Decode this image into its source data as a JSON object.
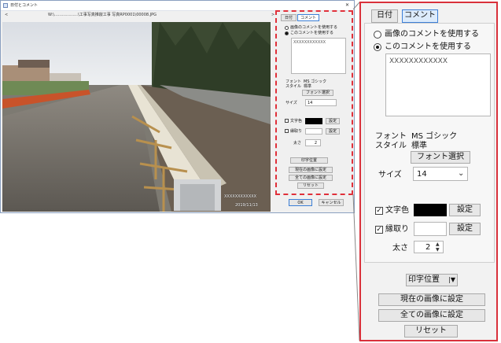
{
  "window": {
    "title": "日付とコメント",
    "file_path": "W:\\………………\\工事写真推敲工事  写真RP0001\\00008.JPG",
    "nav_prev": "<",
    "nav_next": ">",
    "close_glyph": "✕"
  },
  "photo": {
    "stamp_comment": "XXXXXXXXXXXX",
    "stamp_date": "2019/11/13"
  },
  "tabs": [
    "日付",
    "コメント"
  ],
  "comment": {
    "use_image_comment": "画像のコメントを使用する",
    "use_this_comment": "このコメントを使用する",
    "text": "XXXXXXXXXXXX"
  },
  "font": {
    "label": "フォント\nスタイル",
    "label_line1": "フォント",
    "label_line2": "スタイル",
    "name": "MS ゴシック",
    "style": "標準",
    "select_button": "フォント選択",
    "size_label": "サイズ",
    "size_value": "14"
  },
  "text_color": {
    "label": "文字色",
    "swatch": "#000000",
    "set_button": "設定",
    "checked": true
  },
  "outline": {
    "label": "縁取り",
    "swatch": "#ffffff",
    "set_button": "設定",
    "checked": true,
    "thickness_label": "太さ",
    "thickness_value": "2"
  },
  "actions": {
    "print_position": "印字位置",
    "apply_current": "現在の画像に設定",
    "apply_all": "全ての画像に設定",
    "reset": "リセット"
  },
  "dialog_buttons": {
    "ok": "OK",
    "cancel": "キャンセル"
  },
  "colors": {
    "highlight": "#d9313b",
    "tab_active_border": "#3c7fd6"
  }
}
